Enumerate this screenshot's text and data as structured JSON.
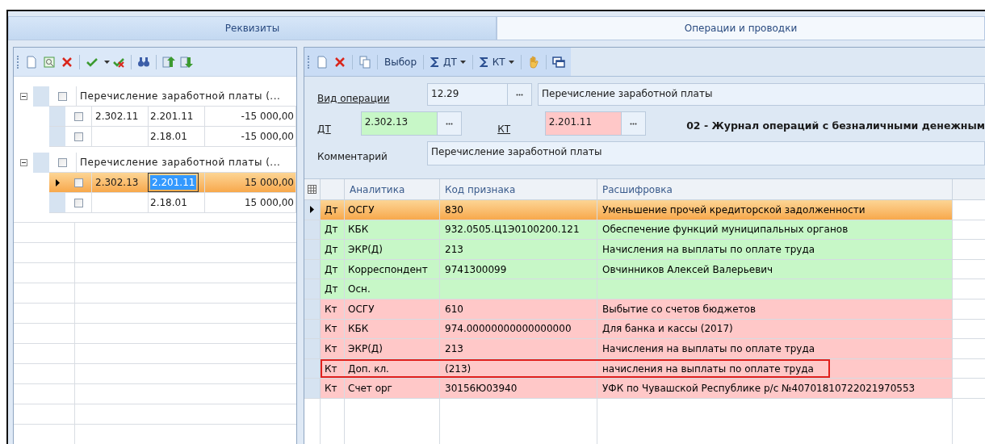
{
  "tabs": [
    {
      "label": "Реквизиты",
      "selected": false
    },
    {
      "label": "Операции и проводки",
      "selected": true
    }
  ],
  "tree": {
    "groups": [
      {
        "title": "Перечисление заработной платы (...",
        "expanded": true,
        "checked": false,
        "children": [
          {
            "selected": false,
            "checked": false,
            "cells": [
              {
                "text": "2.302.11",
                "editing": false
              },
              {
                "text": "2.201.11",
                "editing": false
              },
              {
                "text": "-15 000,00",
                "editing": false
              }
            ]
          },
          {
            "selected": false,
            "checked": false,
            "cells": [
              {
                "text": "",
                "editing": false
              },
              {
                "text": "2.18.01",
                "editing": false
              },
              {
                "text": "-15 000,00",
                "editing": false
              }
            ]
          }
        ]
      },
      {
        "title": "Перечисление заработной платы (...",
        "expanded": true,
        "checked": false,
        "children": [
          {
            "selected": true,
            "checked": false,
            "cells": [
              {
                "text": "2.302.13",
                "editing": false
              },
              {
                "text": "2.201.11",
                "editing": true
              },
              {
                "text": "15 000,00",
                "editing": false
              }
            ]
          },
          {
            "selected": false,
            "checked": false,
            "cells": [
              {
                "text": "",
                "editing": false
              },
              {
                "text": "2.18.01",
                "editing": false
              },
              {
                "text": "15 000,00",
                "editing": false
              }
            ]
          }
        ]
      }
    ]
  },
  "right_toolbar": {
    "choose": "Выбор",
    "dt": "ДТ",
    "kt": "КТ"
  },
  "form": {
    "operation_label": "Вид операции",
    "operation_code": "12.29",
    "operation_name": "Перечисление заработной платы",
    "dt_label": "ДТ",
    "dt_value": "2.302.13",
    "kt_label": "КТ",
    "kt_value": "2.201.11",
    "journal": "02 - Журнал операций с безналичными денежным",
    "comment_label": "Комментарий",
    "comment_value": "Перечисление заработной платы"
  },
  "grid": {
    "columns": [
      "Аналитика",
      "Код признака",
      "Расшифровка"
    ],
    "rows": [
      {
        "kind": "debit",
        "selected": true,
        "highlighted": false,
        "side": "Дт",
        "analytics": "ОСГУ",
        "code": "830",
        "decoding": "Уменьшение прочей кредиторской задолженности"
      },
      {
        "kind": "debit",
        "selected": false,
        "highlighted": false,
        "side": "Дт",
        "analytics": "КБК",
        "code": "932.0505.Ц1Э0100200.121",
        "decoding": "Обеспечение функций муниципальных органов"
      },
      {
        "kind": "debit",
        "selected": false,
        "highlighted": false,
        "side": "Дт",
        "analytics": "ЭКР(Д)",
        "code": "213",
        "decoding": "Начисления на выплаты по оплате труда"
      },
      {
        "kind": "debit",
        "selected": false,
        "highlighted": false,
        "side": "Дт",
        "analytics": "Корреспондент",
        "code": "9741300099",
        "decoding": "Овчинников Алексей Валерьевич"
      },
      {
        "kind": "debit",
        "selected": false,
        "highlighted": false,
        "side": "Дт",
        "analytics": "Осн.",
        "code": "",
        "decoding": ""
      },
      {
        "kind": "credit",
        "selected": false,
        "highlighted": false,
        "side": "Кт",
        "analytics": "ОСГУ",
        "code": "610",
        "decoding": "Выбытие со счетов бюджетов"
      },
      {
        "kind": "credit",
        "selected": false,
        "highlighted": false,
        "side": "Кт",
        "analytics": "КБК",
        "code": "974.00000000000000000",
        "decoding": "Для банка и кассы (2017)"
      },
      {
        "kind": "credit",
        "selected": false,
        "highlighted": false,
        "side": "Кт",
        "analytics": "ЭКР(Д)",
        "code": "213",
        "decoding": "Начисления на выплаты по оплате труда"
      },
      {
        "kind": "credit",
        "selected": false,
        "highlighted": true,
        "side": "Кт",
        "analytics": "Доп. кл.",
        "code": "(213)",
        "decoding": "начисления на выплаты по оплате труда"
      },
      {
        "kind": "credit",
        "selected": false,
        "highlighted": false,
        "side": "Кт",
        "analytics": "Счет орг",
        "code": "30156Ю03940",
        "decoding": "УФК по Чувашской Республике р/с №40701810722021970553"
      }
    ]
  }
}
